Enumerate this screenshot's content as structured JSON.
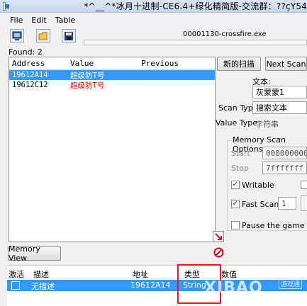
{
  "window": {
    "title": "*^__^*冰月十进制-CE6.4+绿化精简版-交流群：??çY54"
  },
  "menu": [
    "File",
    "Edit",
    "Table"
  ],
  "toolbar": {
    "process": "00001130-crossfire.exe",
    "found": "Found: 2"
  },
  "results": {
    "headers": [
      "Address",
      "Value",
      "Previous"
    ],
    "rows": [
      {
        "address": "19612A14",
        "value": "超级防T号",
        "previous": ""
      },
      {
        "address": "19612C12",
        "value": "超级防T号",
        "previous": ""
      }
    ]
  },
  "scan": {
    "first_scan": "新的扫描",
    "next_scan": "Next Scan",
    "text_label": "文本:",
    "text_value": "灰蒙蒙1",
    "scan_type_label": "Scan Type",
    "scan_type_value": "搜索文本",
    "value_type_label": "Value Type",
    "value_type_value": "字符串"
  },
  "memory_scan": {
    "title": "Memory Scan Options",
    "start_label": "Start",
    "start_value": "000000000",
    "stop_label": "Stop",
    "stop_value": "7fffffff",
    "writable_label": "Writable",
    "fast_scan_label": "Fast Scan",
    "fast_scan_value": "1",
    "pause_label": "Pause the game whi"
  },
  "memory_view": "Memory View",
  "bottom_table": {
    "headers": [
      "激活",
      "描述",
      "地址",
      "类型",
      "数值"
    ],
    "row": {
      "description": "无描述",
      "address": "19612A14",
      "type": "String"
    }
  },
  "watermark": {
    "main": "XIBAO",
    "sub": "游戏通"
  },
  "colors": {
    "selection": "#3399ff",
    "value_red": "#e00000",
    "highlight_red": "#e02020"
  }
}
